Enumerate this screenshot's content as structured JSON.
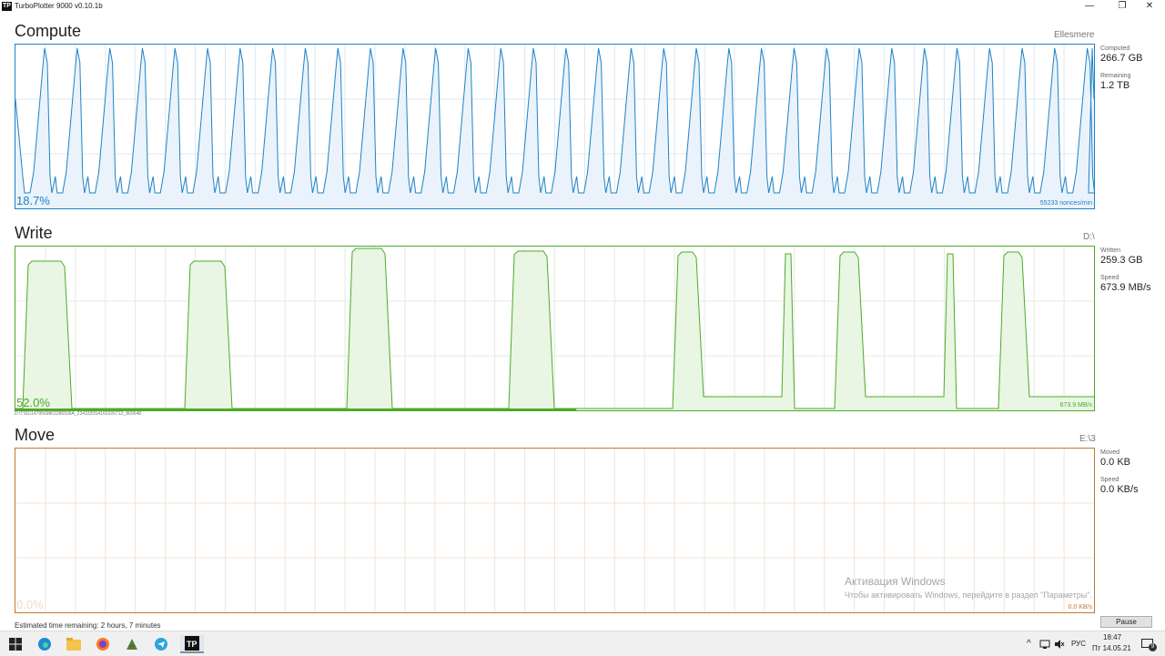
{
  "window": {
    "title": "TurboPlotter 9000 v0.10.1b",
    "app_icon_text": "TP",
    "minimize_icon": "—",
    "maximize_icon": "❐",
    "close_icon": "✕"
  },
  "compute": {
    "title": "Compute",
    "device": "Ellesmere",
    "percent": "18.7%",
    "rate": "55233 nonces/min",
    "color": "#1f82c7",
    "fill": "#eaf3fb",
    "stats": [
      {
        "label": "Computed",
        "value": "266.7 GB"
      },
      {
        "label": "Remaining",
        "value": "1.2 TB"
      }
    ]
  },
  "write": {
    "title": "Write",
    "device": "D:\\",
    "percent": "52.0%",
    "rate": "673.9 MB/s",
    "progress": 0.52,
    "file_path": "D:\\TSG\\1479569803286506A_2343320S416032671Z_860648",
    "color": "#4daa2a",
    "fill": "#e9f6e3",
    "stats": [
      {
        "label": "Written",
        "value": "259.3 GB"
      },
      {
        "label": "Speed",
        "value": "673.9 MB/s"
      }
    ]
  },
  "move": {
    "title": "Move",
    "device": "E:\\3",
    "percent": "0.0%",
    "rate": "0.0 KB/s",
    "color": "#c27a2e",
    "stats": [
      {
        "label": "Moved",
        "value": "0.0 KB"
      },
      {
        "label": "Speed",
        "value": "0.0 KB/s"
      }
    ]
  },
  "status": {
    "eta": "Estimated time remaining: 2 hours, 7 minutes",
    "pause_label": "Pause"
  },
  "watermark": {
    "title": "Активация Windows",
    "text": "Чтобы активировать Windows, перейдите в раздел \"Параметры\"."
  },
  "taskbar": {
    "apps": [
      "start-icon",
      "edge-icon",
      "file-explorer-icon",
      "firefox-icon",
      "game-icon",
      "telegram-icon",
      "turboplotter-icon"
    ],
    "chevron": "^",
    "language": "РУС",
    "time": "18:47",
    "date": "Пт 14.05.21",
    "notification_count": "9"
  }
}
